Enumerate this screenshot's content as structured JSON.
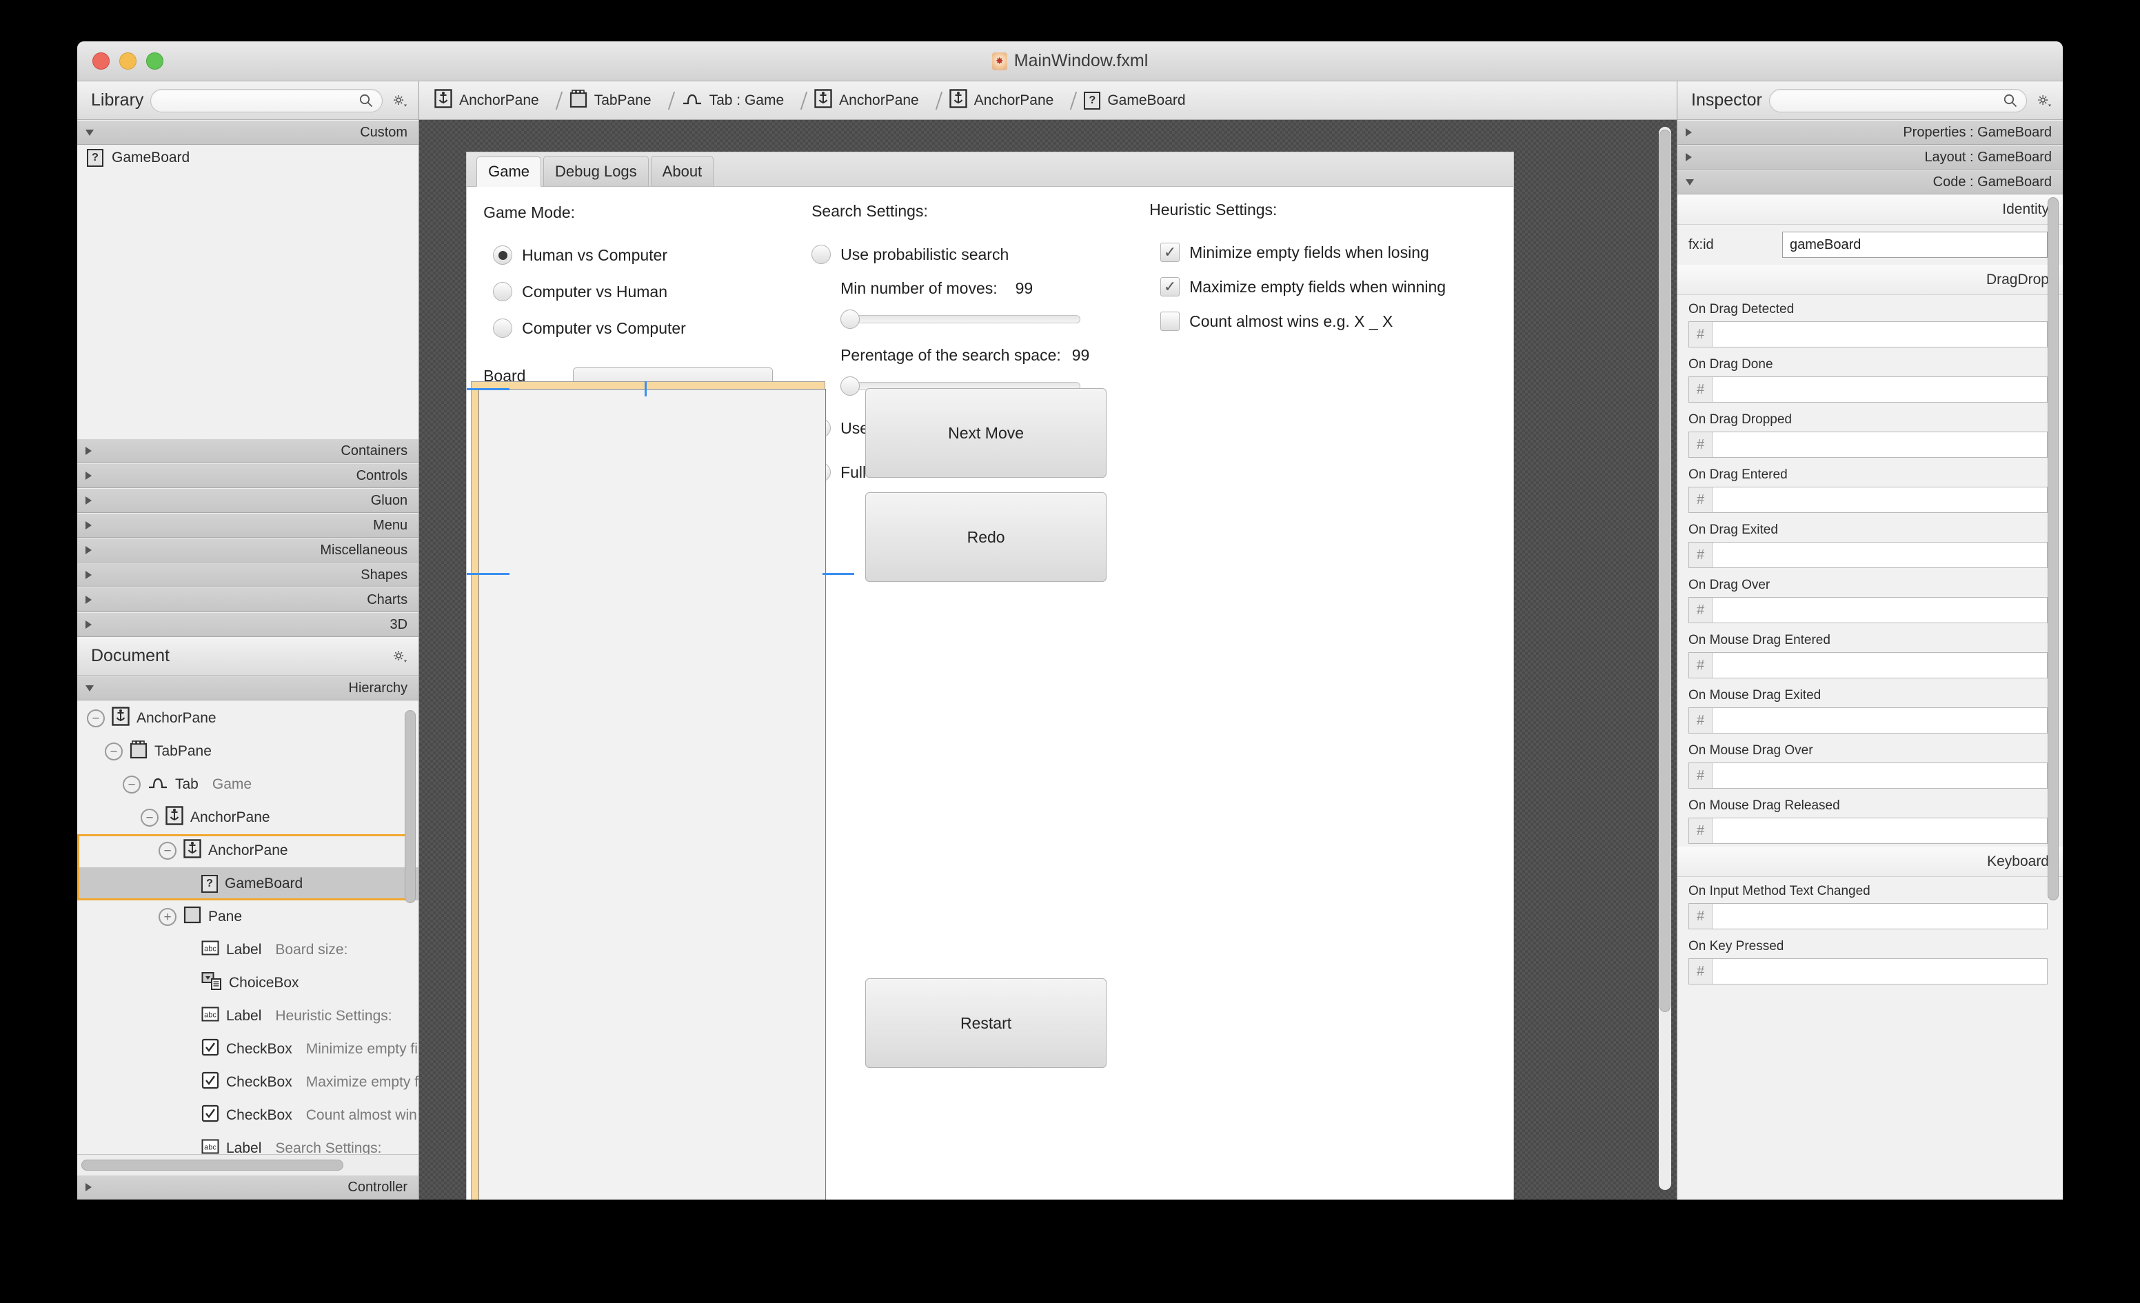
{
  "window": {
    "title": "MainWindow.fxml"
  },
  "library": {
    "title": "Library",
    "search_placeholder": "",
    "search_value": "",
    "custom_section": "Custom",
    "items": [
      {
        "label": "GameBoard",
        "icon": "?"
      }
    ],
    "sections": [
      "Containers",
      "Controls",
      "Gluon",
      "Menu",
      "Miscellaneous",
      "Shapes",
      "Charts",
      "3D"
    ]
  },
  "document": {
    "title": "Document",
    "hierarchy_label": "Hierarchy",
    "controller_label": "Controller",
    "tree": [
      {
        "toggle": "minus",
        "icon": "anchor",
        "type": "AnchorPane",
        "value": "",
        "indent": 0,
        "selected": false
      },
      {
        "toggle": "minus",
        "icon": "tabpane",
        "type": "TabPane",
        "value": "",
        "indent": 1,
        "selected": false
      },
      {
        "toggle": "minus",
        "icon": "tab",
        "type": "Tab",
        "value": "Game",
        "indent": 2,
        "selected": false
      },
      {
        "toggle": "minus",
        "icon": "anchor",
        "type": "AnchorPane",
        "value": "",
        "indent": 3,
        "selected": false
      },
      {
        "toggle": "minus",
        "icon": "anchor",
        "type": "AnchorPane",
        "value": "",
        "indent": 4,
        "selected": false
      },
      {
        "toggle": "none",
        "icon": "?",
        "type": "GameBoard",
        "value": "",
        "indent": 5,
        "selected": true
      },
      {
        "toggle": "plus",
        "icon": "pane",
        "type": "Pane",
        "value": "",
        "indent": 4,
        "selected": false
      },
      {
        "toggle": "none",
        "icon": "abc",
        "type": "Label",
        "value": "Board size:",
        "indent": 5,
        "selected": false
      },
      {
        "toggle": "none",
        "icon": "choice",
        "type": "ChoiceBox",
        "value": "",
        "indent": 5,
        "selected": false
      },
      {
        "toggle": "none",
        "icon": "abc",
        "type": "Label",
        "value": "Heuristic Settings:",
        "indent": 5,
        "selected": false
      },
      {
        "toggle": "none",
        "icon": "check",
        "type": "CheckBox",
        "value": "Minimize empty fi",
        "indent": 5,
        "selected": false
      },
      {
        "toggle": "none",
        "icon": "check",
        "type": "CheckBox",
        "value": "Maximize empty f",
        "indent": 5,
        "selected": false
      },
      {
        "toggle": "none",
        "icon": "check",
        "type": "CheckBox",
        "value": "Count almost win",
        "indent": 5,
        "selected": false
      },
      {
        "toggle": "none",
        "icon": "abc",
        "type": "Label",
        "value": "Search Settings:",
        "indent": 5,
        "selected": false
      }
    ]
  },
  "breadcrumb": [
    {
      "label": "AnchorPane",
      "icon": "anchor"
    },
    {
      "label": "TabPane",
      "icon": "tabpane"
    },
    {
      "label": "Tab : Game",
      "icon": "tab"
    },
    {
      "label": "AnchorPane",
      "icon": "anchor"
    },
    {
      "label": "AnchorPane",
      "icon": "anchor"
    },
    {
      "label": "GameBoard",
      "icon": "?"
    }
  ],
  "stage": {
    "tabs": [
      {
        "label": "Game",
        "active": true
      },
      {
        "label": "Debug Logs",
        "active": false
      },
      {
        "label": "About",
        "active": false
      }
    ],
    "game_mode": {
      "title": "Game Mode:",
      "options": [
        {
          "label": "Human vs Computer",
          "selected": true
        },
        {
          "label": "Computer vs Human",
          "selected": false
        },
        {
          "label": "Computer vs Computer",
          "selected": false
        }
      ],
      "board_size_label": "Board size:",
      "board_size_value": ""
    },
    "search_settings": {
      "title": "Search Settings:",
      "probabilistic_label": "Use probabilistic search",
      "probabilistic_selected": false,
      "min_moves_label": "Min number of moves:",
      "min_moves_value": "99",
      "min_moves_slider": 0,
      "percentage_label": "Perentage of the search space:",
      "percentage_value": "99",
      "percentage_slider": 0,
      "cutoff_label": "Use cut-off level",
      "cutoff_selected": false,
      "cutoff_value": "",
      "full_search_label": "Full search",
      "full_search_selected": true
    },
    "heuristic_settings": {
      "title": "Heuristic Settings:",
      "options": [
        {
          "label": "Minimize empty fields when losing",
          "checked": true
        },
        {
          "label": "Maximize empty fields when winning",
          "checked": true
        },
        {
          "label": "Count almost wins e.g. X _ X",
          "checked": false
        }
      ]
    },
    "buttons": [
      {
        "label": "Next Move"
      },
      {
        "label": "Redo"
      },
      {
        "label": "Restart"
      }
    ]
  },
  "inspector": {
    "title": "Inspector",
    "search_placeholder": "",
    "search_value": "",
    "sections": [
      {
        "label": "Properties : GameBoard",
        "expanded": false
      },
      {
        "label": "Layout : GameBoard",
        "expanded": false
      },
      {
        "label": "Code : GameBoard",
        "expanded": true
      }
    ],
    "identity_label": "Identity",
    "fxid_label": "fx:id",
    "fxid_value": "gameBoard",
    "dragdrop_label": "DragDrop",
    "dragdrop_fields": [
      {
        "label": "On Drag Detected",
        "value": ""
      },
      {
        "label": "On Drag Done",
        "value": ""
      },
      {
        "label": "On Drag Dropped",
        "value": ""
      },
      {
        "label": "On Drag Entered",
        "value": ""
      },
      {
        "label": "On Drag Exited",
        "value": ""
      },
      {
        "label": "On Drag Over",
        "value": ""
      },
      {
        "label": "On Mouse Drag Entered",
        "value": ""
      },
      {
        "label": "On Mouse Drag Exited",
        "value": ""
      },
      {
        "label": "On Mouse Drag Over",
        "value": ""
      },
      {
        "label": "On Mouse Drag Released",
        "value": ""
      }
    ],
    "keyboard_label": "Keyboard",
    "keyboard_fields": [
      {
        "label": "On Input Method Text Changed",
        "value": ""
      },
      {
        "label": "On Key Pressed",
        "value": ""
      }
    ]
  },
  "colors": {
    "selection_orange": "#f0a830",
    "selection_band": "#f7d9a0",
    "guide_blue": "#3b8ff0",
    "canvas_bg": "#4a4a4a"
  }
}
